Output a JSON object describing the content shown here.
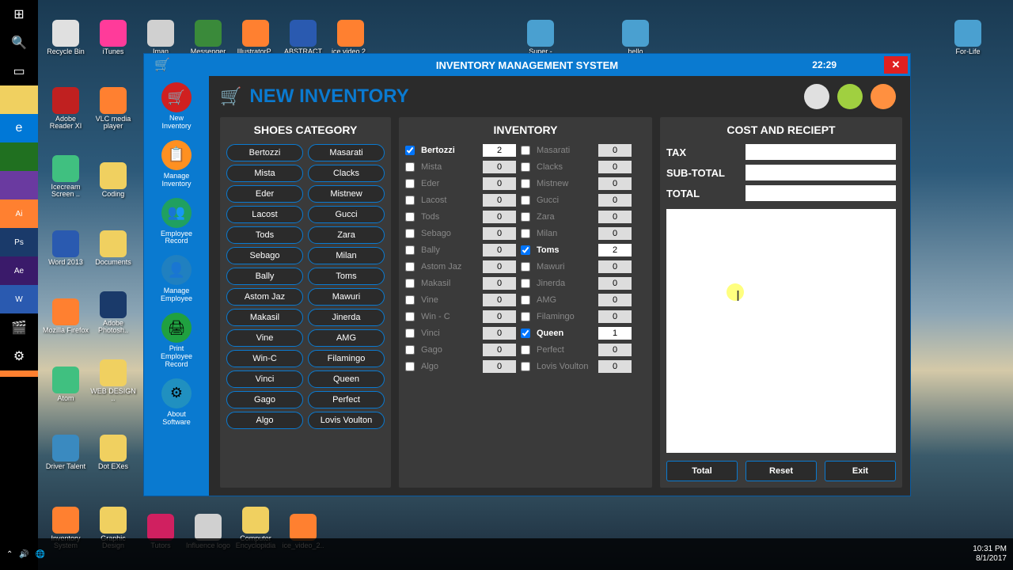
{
  "desktop": {
    "row1": [
      {
        "label": "Recycle Bin",
        "color": "#e0e0e0"
      },
      {
        "label": "iTunes",
        "color": "#ff3b9a"
      },
      {
        "label": "Iman",
        "color": "#d0d0d0"
      },
      {
        "label": "Messenger",
        "color": "#3a8a3a"
      },
      {
        "label": "IllustratorP..",
        "color": "#ff8030"
      },
      {
        "label": "ABSTRACT",
        "color": "#2a5ab0"
      },
      {
        "label": "ice video 2..",
        "color": "#ff8030"
      },
      {
        "label": "",
        "color": "transparent"
      },
      {
        "label": "",
        "color": "transparent"
      },
      {
        "label": "",
        "color": "transparent"
      },
      {
        "label": "Super -",
        "color": "#4aa0d0"
      },
      {
        "label": "",
        "color": "transparent"
      },
      {
        "label": "hello",
        "color": "#4aa0d0"
      },
      {
        "label": "",
        "color": "transparent"
      },
      {
        "label": "",
        "color": "transparent"
      },
      {
        "label": "",
        "color": "transparent"
      },
      {
        "label": "",
        "color": "transparent"
      },
      {
        "label": "",
        "color": "transparent"
      },
      {
        "label": "",
        "color": "transparent"
      },
      {
        "label": "For-Life",
        "color": "#4aa0d0"
      }
    ],
    "col_icons": [
      {
        "label": "Adobe Reader XI",
        "color": "#c02020"
      },
      {
        "label": "VLC media player",
        "color": "#ff8030"
      },
      {
        "label": "Icecream Screen ..",
        "color": "#40c080"
      },
      {
        "label": "Coding",
        "color": "#f0d060"
      },
      {
        "label": "Word 2013",
        "color": "#2a5ab0"
      },
      {
        "label": "Documents",
        "color": "#f0d060"
      },
      {
        "label": "Mozilla Firefox",
        "color": "#ff8030"
      },
      {
        "label": "Adobe Photosh..",
        "color": "#1a3a6a"
      },
      {
        "label": "Atom",
        "color": "#40c080"
      },
      {
        "label": "WEB DESIGN ..",
        "color": "#f0d060"
      },
      {
        "label": "Driver Talent",
        "color": "#3a8ac0"
      },
      {
        "label": "Dot EXes",
        "color": "#f0d060"
      }
    ],
    "row_bottom": [
      {
        "label": "Inventory System",
        "color": "#ff8030"
      },
      {
        "label": "Graphic Design",
        "color": "#f0d060"
      },
      {
        "label": "Tutors",
        "color": "#d02060"
      },
      {
        "label": "Influence logo",
        "color": "#d0d0d0"
      },
      {
        "label": "Computer Encyclopidia",
        "color": "#f0d060"
      },
      {
        "label": "ice_video_2..",
        "color": "#ff8030"
      }
    ]
  },
  "taskbar": {
    "time": "10:31 PM",
    "date": "8/1/2017"
  },
  "app": {
    "title": "INVENTORY MANAGEMENT SYSTEM",
    "time": "22:29",
    "page_title": "NEW INVENTORY"
  },
  "sidebar": {
    "items": [
      {
        "label": "New Inventory",
        "color": "#d02020",
        "glyph": "🛒"
      },
      {
        "label": "Manage Inventory",
        "color": "#ff9020",
        "glyph": "📋"
      },
      {
        "label": "Employee Record",
        "color": "#20a060",
        "glyph": "👥"
      },
      {
        "label": "Manage Employee",
        "color": "#2080c0",
        "glyph": "👤"
      },
      {
        "label": "Print Employee Record",
        "color": "#20a040",
        "glyph": "🖨"
      },
      {
        "label": "About Software",
        "color": "#2090c0",
        "glyph": "⚙"
      }
    ]
  },
  "category": {
    "title": "SHOES CATEGORY",
    "items": [
      "Bertozzi",
      "Masarati",
      "Mista",
      "Clacks",
      "Eder",
      "Mistnew",
      "Lacost",
      "Gucci",
      "Tods",
      "Zara",
      "Sebago",
      "Milan",
      "Bally",
      "Toms",
      "Astom Jaz",
      "Mawuri",
      "Makasil",
      "Jinerda",
      "Vine",
      "AMG",
      "Win-C",
      "Filamingo",
      "Vinci",
      "Queen",
      "Gago",
      "Perfect",
      "Algo",
      "Lovis Voulton"
    ]
  },
  "inventory": {
    "title": "INVENTORY",
    "rows": [
      {
        "l": "Bertozzi",
        "lc": true,
        "lv": "2",
        "r": "Masarati",
        "rc": false,
        "rv": "0"
      },
      {
        "l": "Mista",
        "lc": false,
        "lv": "0",
        "r": "Clacks",
        "rc": false,
        "rv": "0"
      },
      {
        "l": "Eder",
        "lc": false,
        "lv": "0",
        "r": "Mistnew",
        "rc": false,
        "rv": "0"
      },
      {
        "l": "Lacost",
        "lc": false,
        "lv": "0",
        "r": "Gucci",
        "rc": false,
        "rv": "0"
      },
      {
        "l": "Tods",
        "lc": false,
        "lv": "0",
        "r": "Zara",
        "rc": false,
        "rv": "0"
      },
      {
        "l": "Sebago",
        "lc": false,
        "lv": "0",
        "r": "Milan",
        "rc": false,
        "rv": "0"
      },
      {
        "l": "Bally",
        "lc": false,
        "lv": "0",
        "r": "Toms",
        "rc": true,
        "rv": "2"
      },
      {
        "l": "Astom Jaz",
        "lc": false,
        "lv": "0",
        "r": "Mawuri",
        "rc": false,
        "rv": "0"
      },
      {
        "l": "Makasil",
        "lc": false,
        "lv": "0",
        "r": "Jinerda",
        "rc": false,
        "rv": "0"
      },
      {
        "l": "Vine",
        "lc": false,
        "lv": "0",
        "r": "AMG",
        "rc": false,
        "rv": "0"
      },
      {
        "l": "Win - C",
        "lc": false,
        "lv": "0",
        "r": "Filamingo",
        "rc": false,
        "rv": "0"
      },
      {
        "l": "Vinci",
        "lc": false,
        "lv": "0",
        "r": "Queen",
        "rc": true,
        "rv": "1"
      },
      {
        "l": "Gago",
        "lc": false,
        "lv": "0",
        "r": "Perfect",
        "rc": false,
        "rv": "0"
      },
      {
        "l": "Algo",
        "lc": false,
        "lv": "0",
        "r": "Lovis Voulton",
        "rc": false,
        "rv": "0"
      }
    ]
  },
  "cost": {
    "title": "COST AND RECIEPT",
    "tax_label": "TAX",
    "subtotal_label": "SUB-TOTAL",
    "total_label": "TOTAL",
    "total_btn": "Total",
    "reset_btn": "Reset",
    "exit_btn": "Exit"
  },
  "header_circles": [
    "#e0e0e0",
    "#a0d040",
    "#ff9040"
  ]
}
